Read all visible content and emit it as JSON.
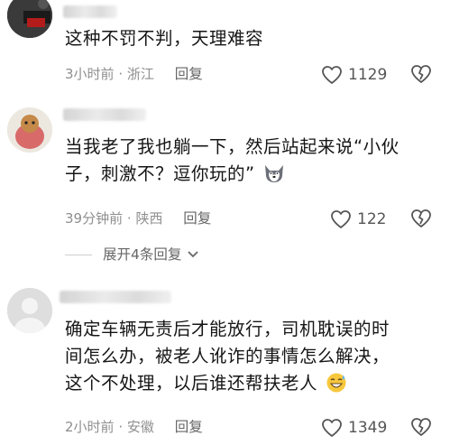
{
  "comments": [
    {
      "text_lines": [
        "这种不罚不判，天理难容"
      ],
      "time": "3小时前",
      "location": "浙江",
      "reply_label": "回复",
      "likes": "1129"
    },
    {
      "text_lines": [
        "当我老了我也躺一下，然后站起来说“小伙",
        "子，刺激不？逗你玩的”"
      ],
      "time": "39分钟前",
      "location": "陕西",
      "reply_label": "回复",
      "likes": "122",
      "emoji": "husky-face-icon"
    },
    {
      "text_lines": [
        "确定车辆无责后才能放行，司机耽误的时",
        "间怎么办，被老人讹诈的事情怎么解决，",
        "这个不处理，以后谁还帮扶老人"
      ],
      "time": "2小时前",
      "location": "安徽",
      "reply_label": "回复",
      "likes": "1349",
      "emoji": "sweat-smile-icon"
    }
  ],
  "expand_replies": "展开4条回复",
  "separator": "·",
  "colors": {
    "text": "#161616",
    "meta": "#8f8f8f",
    "icon": "#555555"
  }
}
